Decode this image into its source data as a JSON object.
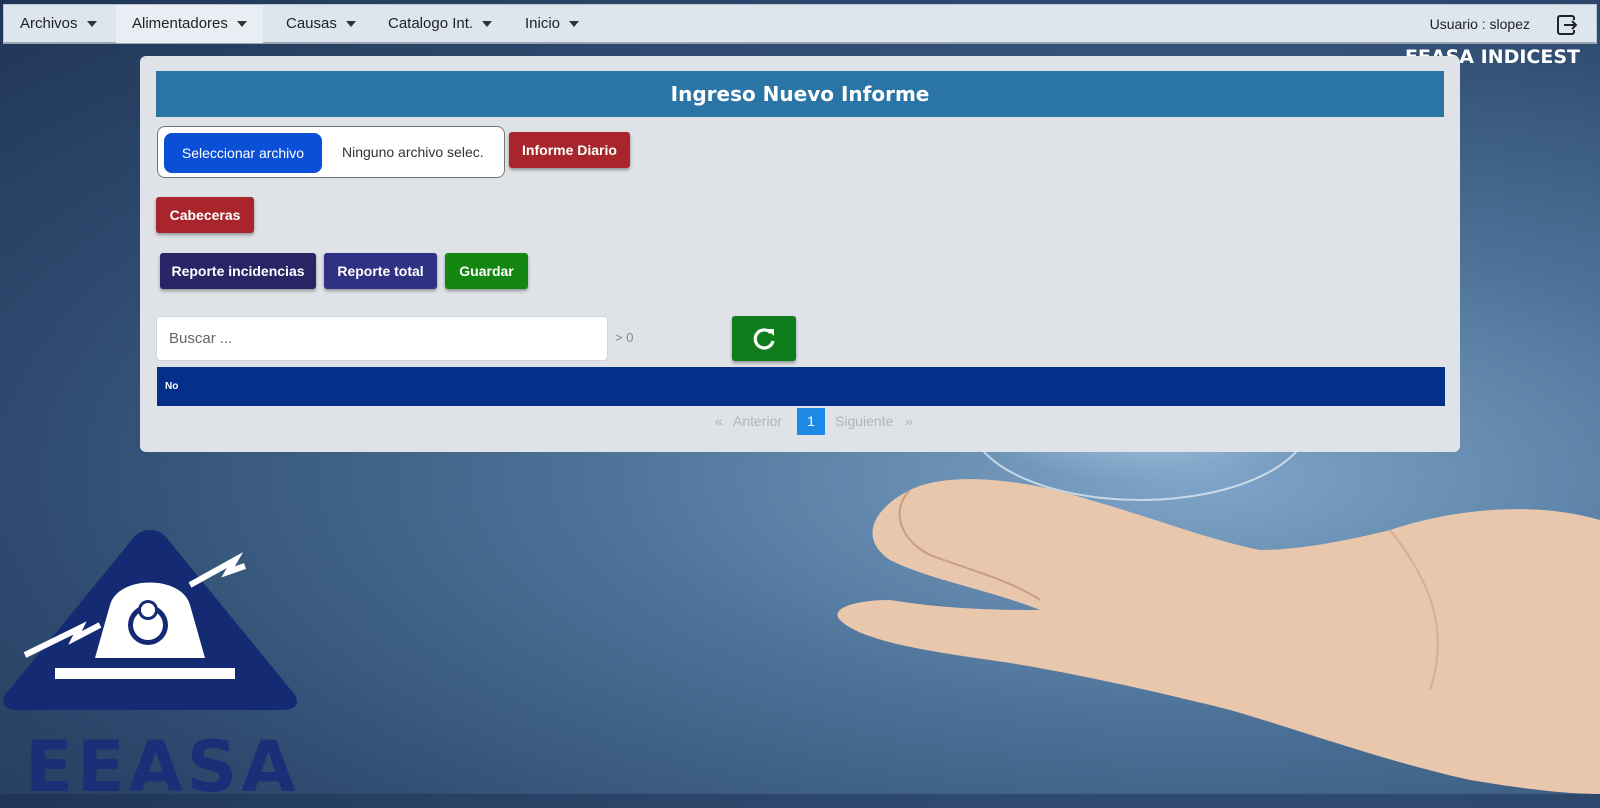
{
  "nav": {
    "items": [
      {
        "label": "Archivos"
      },
      {
        "label": "Alimentadores"
      },
      {
        "label": "Causas"
      },
      {
        "label": "Catalogo Int."
      },
      {
        "label": "Inicio"
      }
    ],
    "user_label": "Usuario : slopez",
    "brand": "EEASA INDICEST"
  },
  "panel": {
    "title": "Ingreso Nuevo Informe",
    "file_button_label": "Seleccionar archivo",
    "file_name": "Ninguno archivo selec.",
    "informe_diario_label": "Informe Diario",
    "cabeceras_label": "Cabeceras",
    "reporte_incidencias_label": "Reporte incidencias",
    "reporte_total_label": "Reporte total",
    "guardar_label": "Guardar",
    "search_placeholder": "Buscar ...",
    "search_value": "",
    "count_text": "> 0",
    "table_header": "No",
    "pagination": {
      "first": "«",
      "prev": "Anterior",
      "current_page": "1",
      "next": "Siguiente",
      "last": "»"
    }
  },
  "logo": {
    "text": "EEASA"
  },
  "colors": {
    "header": "#2a74a6",
    "table_header": "#04308a",
    "red_button": "#a8262b",
    "green_button": "#138612",
    "file_button": "#0b4fd6"
  }
}
